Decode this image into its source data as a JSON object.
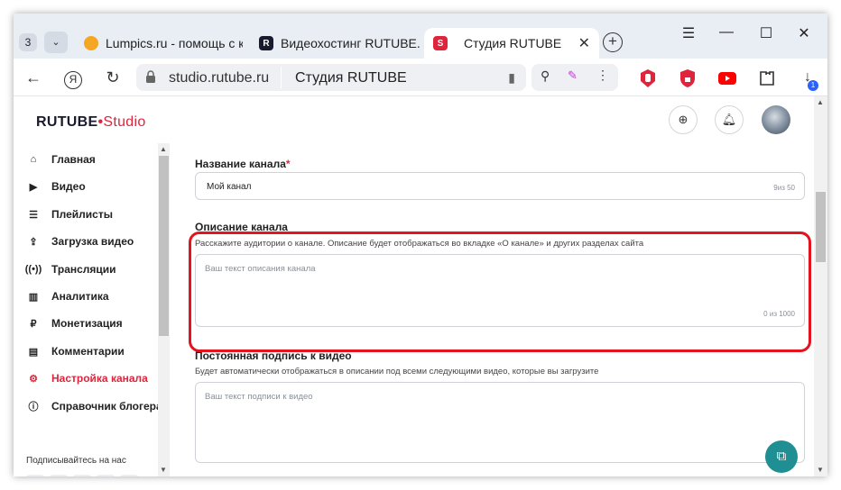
{
  "browser": {
    "tab_count": "3",
    "tabs": [
      {
        "title": "Lumpics.ru - помощь с кс"
      },
      {
        "title": "Видеохостинг RUTUBE. С"
      },
      {
        "title": "Студия RUTUBE"
      }
    ],
    "address": {
      "url": "studio.rutube.ru",
      "page_title": "Студия RUTUBE"
    },
    "download_badge": "1",
    "colors": {
      "accent": "#e0243b",
      "highlight": "#e3141f",
      "fab": "#1f8f94"
    }
  },
  "app": {
    "logo": {
      "brand": "RUTUBE",
      "suffix": "Studio"
    },
    "sidebar": {
      "items": [
        {
          "label": "Главная",
          "icon": "home-icon"
        },
        {
          "label": "Видео",
          "icon": "video-icon"
        },
        {
          "label": "Плейлисты",
          "icon": "playlist-icon"
        },
        {
          "label": "Загрузка видео",
          "icon": "upload-icon"
        },
        {
          "label": "Трансляции",
          "icon": "broadcast-icon"
        },
        {
          "label": "Аналитика",
          "icon": "analytics-icon"
        },
        {
          "label": "Монетизация",
          "icon": "ruble-icon"
        },
        {
          "label": "Комментарии",
          "icon": "comment-icon"
        },
        {
          "label": "Настройка канала",
          "icon": "gear-icon",
          "active": true
        },
        {
          "label": "Справочник блогера",
          "icon": "info-icon"
        }
      ],
      "follow_text": "Подписывайтесь на нас"
    },
    "form": {
      "channel_name": {
        "label": "Название канала",
        "required_mark": "*",
        "value": "Мой канал",
        "counter": "9из 50"
      },
      "channel_description": {
        "label": "Описание канала",
        "help": "Расскажите аудитории о канале. Описание будет отображаться во вкладке «О канале» и других разделах сайта",
        "placeholder": "Ваш текст описания канала",
        "counter": "0 из 1000"
      },
      "video_signature": {
        "label": "Постоянная подпись к видео",
        "help": "Будет автоматически отображаться в описании под всеми следующими видео, которые вы загрузите",
        "placeholder": "Ваш текст подписи к видео"
      }
    }
  }
}
